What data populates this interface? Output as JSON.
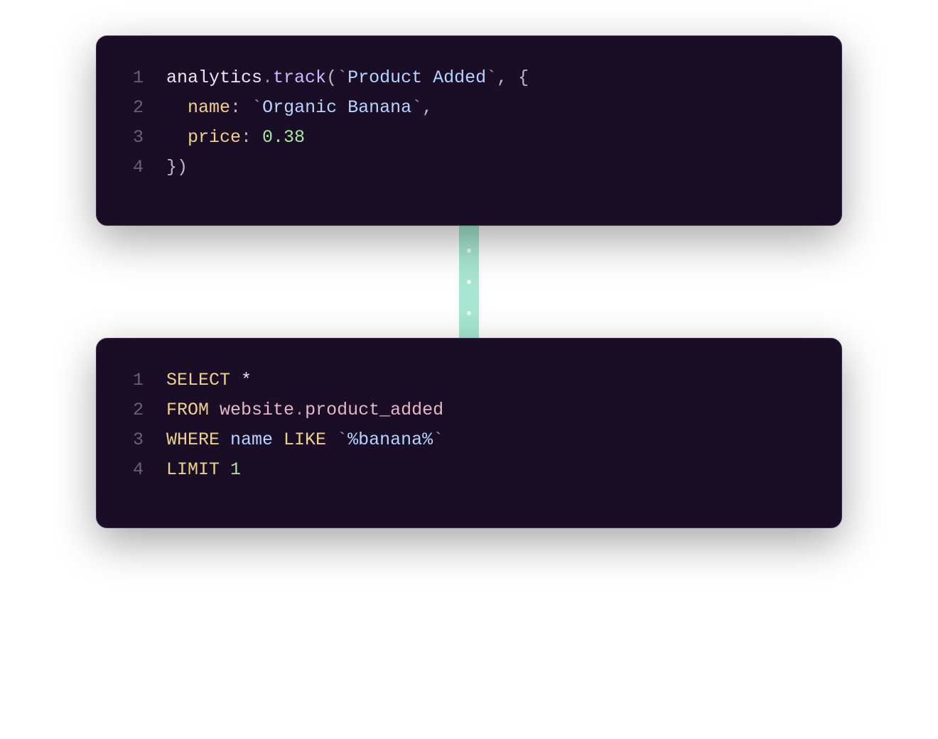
{
  "block1": {
    "lines": [
      "1",
      "2",
      "3",
      "4"
    ],
    "l1": {
      "obj": "analytics",
      "dot": ".",
      "method": "track",
      "open": "(",
      "tick1": "`",
      "str": "Product Added",
      "tick2": "`",
      "comma": ", ",
      "brace": "{"
    },
    "l2": {
      "indent": "  ",
      "prop": "name",
      "colon": ": ",
      "tick1": "`",
      "str": "Organic Banana",
      "tick2": "`",
      "comma": ","
    },
    "l3": {
      "indent": "  ",
      "prop": "price",
      "colon": ": ",
      "num": "0.38"
    },
    "l4": {
      "brace": "}",
      "close": ")"
    }
  },
  "block2": {
    "lines": [
      "1",
      "2",
      "3",
      "4"
    ],
    "l1": {
      "kw": "SELECT ",
      "star": "*"
    },
    "l2": {
      "kw": "FROM ",
      "schema": "website",
      "dot": ".",
      "table": "product_added"
    },
    "l3": {
      "kw1": "WHERE ",
      "ident": "name ",
      "kw2": "LIKE ",
      "tick1": "`",
      "lit": "%banana%",
      "tick2": "`"
    },
    "l4": {
      "kw": "LIMIT ",
      "num": "1"
    }
  }
}
